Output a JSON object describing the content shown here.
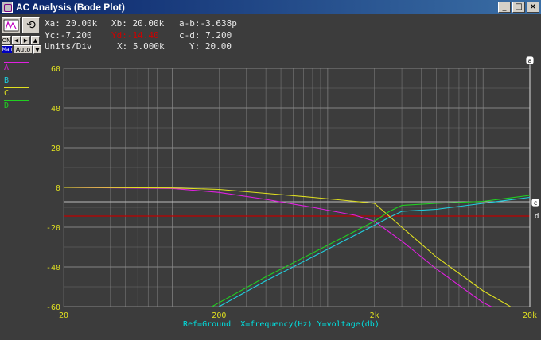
{
  "window": {
    "title": "AC Analysis (Bode Plot)",
    "controls": [
      "_",
      "□",
      "×"
    ]
  },
  "toolbar": {
    "cycle": "⟲",
    "on": "ON",
    "left": "◀",
    "right": "▶",
    "up": "▲",
    "man": "Man",
    "auto": "Auto",
    "down": "▼"
  },
  "readouts": {
    "xa": "Xa: 20.00k",
    "xb": "Xb: 20.00k",
    "ab": "a-b:-3.638p",
    "yc": "Yc:-7.200",
    "yd": "Yd:-14.40",
    "cd": "c-d: 7.200",
    "units": "Units/Div",
    "xdiv": "X: 5.000k",
    "ydiv": "Y: 20.00"
  },
  "colors": {
    "background": "#3c3c3c",
    "grid": "#8c8c8c",
    "A": "#e020e0",
    "B": "#20d0e0",
    "C": "#e0e020",
    "D": "#20d020",
    "cursor_red": "#c00000",
    "axis_text": "#e0e020",
    "caption": "#00e0e0"
  },
  "cursor_labels": {
    "c": "c",
    "d": "d",
    "a": "a"
  },
  "x_caption": "Ref=Ground  X=frequency(Hz) Y=voltage(db)",
  "chart_data": {
    "type": "line",
    "xscale": "log",
    "xlim": [
      20,
      20000
    ],
    "ylim": [
      -60,
      60
    ],
    "yticks": [
      60,
      40,
      20,
      0,
      -20,
      -40,
      -60
    ],
    "xticks": [
      20,
      200,
      2000,
      20000
    ],
    "xticklabels": [
      "20",
      "200",
      "2k",
      "20k"
    ],
    "grid": true,
    "legend_position": "left",
    "series": [
      {
        "name": "A",
        "x": [
          20,
          100,
          200,
          400,
          800,
          1500,
          2000,
          3000,
          5000,
          10000,
          12000
        ],
        "y": [
          0,
          -0.5,
          -2.5,
          -6,
          -10,
          -14,
          -17,
          -27,
          -41,
          -58,
          -61
        ]
      },
      {
        "name": "B",
        "x": [
          200,
          400,
          800,
          1500,
          2000,
          2500,
          3000,
          5000,
          10000,
          20000
        ],
        "y": [
          -60,
          -47,
          -35,
          -24,
          -19,
          -15,
          -12,
          -11,
          -8,
          -5
        ]
      },
      {
        "name": "C",
        "x": [
          20,
          100,
          200,
          400,
          800,
          1500,
          2000,
          3000,
          5000,
          10000,
          15000
        ],
        "y": [
          0,
          -0.3,
          -1,
          -3,
          -5,
          -7,
          -8,
          -20,
          -35,
          -52,
          -60
        ]
      },
      {
        "name": "D",
        "x": [
          180,
          400,
          800,
          1500,
          2000,
          2500,
          3000,
          5000,
          10000,
          20000
        ],
        "y": [
          -60,
          -45,
          -33,
          -22,
          -17,
          -12,
          -9,
          -8,
          -7,
          -4
        ]
      }
    ],
    "cursors": [
      {
        "name": "c",
        "y": -7.2
      },
      {
        "name": "d",
        "y": -14.4
      },
      {
        "name": "a",
        "x": 20000
      }
    ]
  }
}
